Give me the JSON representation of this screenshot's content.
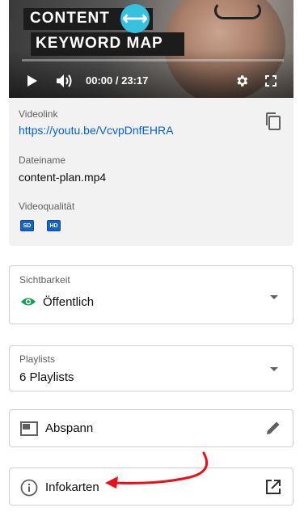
{
  "video": {
    "overlay_title_line1": "CONTENT",
    "overlay_title_line2": "KEYWORD MAP",
    "time_display": "00:00 / 23:17",
    "play_icon": "play-icon",
    "volume_icon": "volume-icon",
    "settings_icon": "gear-icon",
    "fullscreen_icon": "fullscreen-icon"
  },
  "details": {
    "videolink_label": "Videolink",
    "videolink_url": "https://youtu.be/VcvpDnfEHRA",
    "filename_label": "Dateiname",
    "filename_value": "content-plan.mp4",
    "quality_label": "Videoqualität",
    "quality_badges": [
      "SD",
      "HD"
    ]
  },
  "visibility": {
    "label": "Sichtbarkeit",
    "value": "Öffentlich",
    "icon": "eye-icon"
  },
  "playlists": {
    "label": "Playlists",
    "value": "6 Playlists"
  },
  "endscreen": {
    "label": "Abspann",
    "icon": "endscreen-icon",
    "action_icon": "pencil-icon"
  },
  "cards": {
    "label": "Infokarten",
    "icon": "info-icon",
    "action_icon": "external-link-icon"
  },
  "colors": {
    "accent_link": "#065fd4",
    "visibility_green": "#0f9d58",
    "badge_blue": "#1565c0",
    "annotation_red": "#e8101b",
    "overlay_badge": "#35c1e0"
  }
}
